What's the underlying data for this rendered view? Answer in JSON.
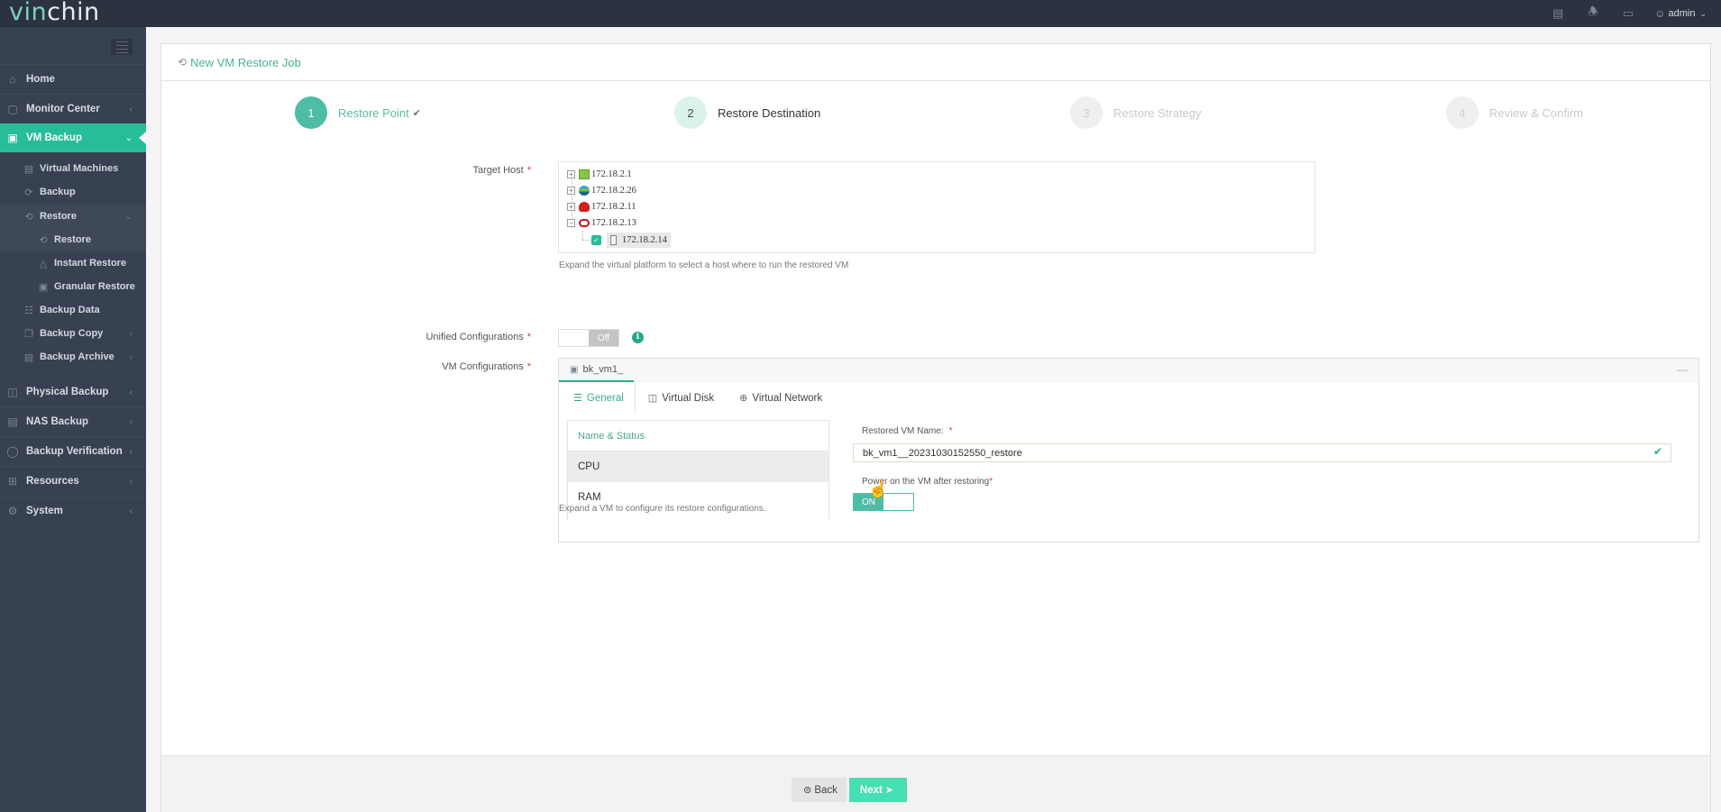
{
  "app": {
    "logo_part1": "vin",
    "logo_part2": "chin",
    "user": "admin",
    "top_icons": [
      "task-list-icon",
      "bell-icon",
      "monitor-icon",
      "user-icon"
    ]
  },
  "sidebar": {
    "items": [
      {
        "label": "Home",
        "icon": "home-icon"
      },
      {
        "label": "Monitor Center",
        "icon": "monitor-center-icon"
      },
      {
        "label": "VM Backup",
        "icon": "vm-icon",
        "active": true
      },
      {
        "label": "Physical Backup",
        "icon": "physical-backup-icon"
      },
      {
        "label": "NAS Backup",
        "icon": "nas-icon"
      },
      {
        "label": "Backup Verification",
        "icon": "verification-icon"
      },
      {
        "label": "Resources",
        "icon": "resources-icon"
      },
      {
        "label": "System",
        "icon": "gear-icon"
      }
    ],
    "vm_backup_children": [
      {
        "label": "Virtual Machines",
        "icon": "chart-icon"
      },
      {
        "label": "Backup",
        "icon": "refresh-icon"
      },
      {
        "label": "Restore",
        "icon": "restore-icon",
        "expanded": true
      },
      {
        "label": "Restore",
        "icon": "restore-icon",
        "selected": true
      },
      {
        "label": "Instant Restore",
        "icon": "rocket-icon"
      },
      {
        "label": "Granular Restore",
        "icon": "granular-icon"
      },
      {
        "label": "Backup Data",
        "icon": "database-icon"
      },
      {
        "label": "Backup Copy",
        "icon": "copy-icon"
      },
      {
        "label": "Backup Archive",
        "icon": "archive-icon"
      }
    ]
  },
  "page": {
    "title": "New VM Restore Job",
    "steps": [
      {
        "number": "1",
        "label": "Restore Point",
        "status": "done"
      },
      {
        "number": "2",
        "label": "Restore Destination",
        "status": "current"
      },
      {
        "number": "3",
        "label": "Restore Strategy",
        "status": "pending"
      },
      {
        "number": "4",
        "label": "Review & Confirm",
        "status": "pending"
      }
    ]
  },
  "form": {
    "target_host": {
      "label": "Target Host",
      "required": "*",
      "nodes": [
        {
          "label": "172.18.2.1",
          "platform": "vmware-icon",
          "expanded": false
        },
        {
          "label": "172.18.2.26",
          "platform": "globe-platform-icon",
          "expanded": false
        },
        {
          "label": "172.18.2.11",
          "platform": "redhat-icon",
          "expanded": false
        },
        {
          "label": "172.18.2.13",
          "platform": "oracle-icon",
          "expanded": true
        }
      ],
      "child": {
        "label": "172.18.2.14",
        "checked": true
      },
      "hint": "Expand the virtual platform to select a host where to run the restored VM"
    },
    "unified": {
      "label": "Unified Configurations",
      "required": "*",
      "toggle": "Off"
    },
    "vm_config": {
      "label": "VM Configurations",
      "required": "*",
      "vm_name": "bk_vm1_",
      "collapse": "—",
      "tabs": [
        {
          "label": "General",
          "active": true
        },
        {
          "label": "Virtual Disk"
        },
        {
          "label": "Virtual Network"
        }
      ],
      "list_header": "Name & Status",
      "list_items": [
        "CPU",
        "RAM"
      ],
      "restored_name_label": "Restored VM Name:",
      "restored_name_value": "bk_vm1__20231030152550_restore",
      "power_label": "Power on the VM after restoring",
      "power_toggle": "ON",
      "hint": "Expand a VM to configure its restore configurations."
    }
  },
  "footer": {
    "back": "Back",
    "next": "Next"
  }
}
